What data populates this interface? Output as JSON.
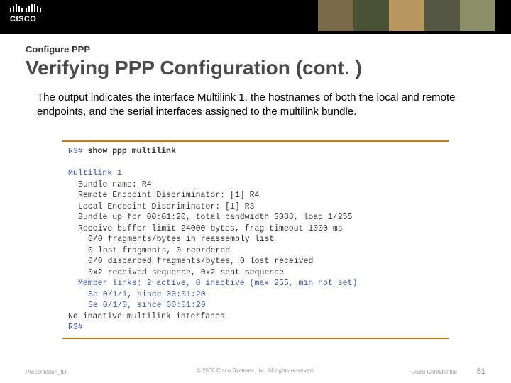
{
  "header": {
    "logo_text": "CISCO"
  },
  "titles": {
    "pre": "Configure PPP",
    "main": "Verifying PPP Configuration (cont. )"
  },
  "body": "The output indicates the interface Multilink 1, the hostnames of both the local and remote endpoints, and the serial interfaces assigned to the multilink bundle.",
  "terminal": {
    "prompt": "R3#",
    "command": "show ppp multilink",
    "lines": {
      "l0": "Multilink 1",
      "l1": "Bundle name: R4",
      "l2": "Remote Endpoint Discriminator: [1] R4",
      "l3": "Local Endpoint Discriminator: [1] R3",
      "l4": "Bundle up for 00:01:20, total bandwidth 3088, load 1/255",
      "l5": "Receive buffer limit 24000 bytes, frag timeout 1000 ms",
      "l6": "0/0 fragments/bytes in reassembly list",
      "l7": "0 lost fragments, 0 reordered",
      "l8": "0/0 discarded fragments/bytes, 0 lost received",
      "l9": "0x2 received sequence, 0x2 sent sequence",
      "l10": "Member links: 2 active, 0 inactive (max 255, min not set)",
      "l11": "Se 0/1/1, since 00:01:20",
      "l12": "Se 0/1/0, since 00:01:20",
      "l13": "No inactive multilink interfaces",
      "l14": "R3#"
    }
  },
  "footer": {
    "left": "Presentation_ID",
    "mid": "© 2008 Cisco Systems, Inc. All rights reserved.",
    "conf": "Cisco Confidential",
    "page": "51"
  }
}
